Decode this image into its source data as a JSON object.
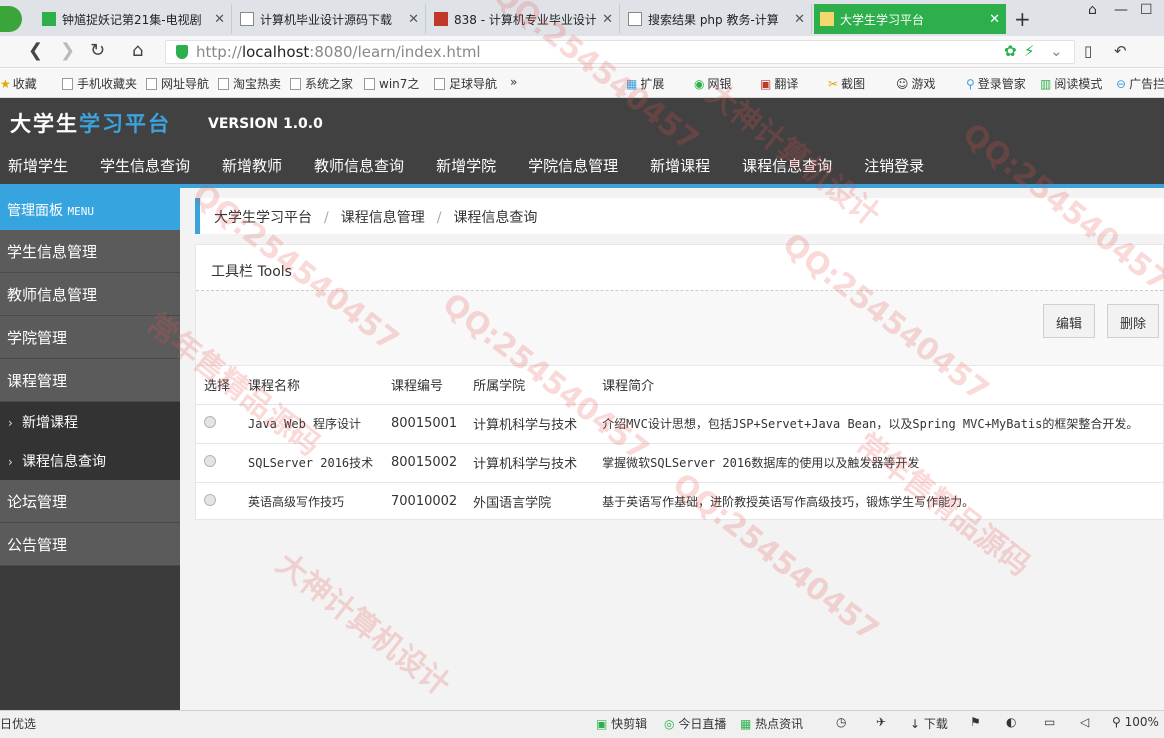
{
  "browser": {
    "tabs": [
      {
        "title": "钟馗捉妖记第21集-电视剧",
        "active": false
      },
      {
        "title": "计算机毕业设计源码下载",
        "active": false
      },
      {
        "title": "838 - 计算机专业毕业设计",
        "active": false
      },
      {
        "title": "搜索结果 php 教务-计算",
        "active": false
      },
      {
        "title": "大学生学习平台",
        "active": true
      }
    ],
    "url_prefix": "http://",
    "url_host": "localhost",
    "url_path": ":8080/learn/index.html",
    "bookmarks": [
      "收藏",
      "手机收藏夹",
      "网址导航",
      "淘宝热卖",
      "系统之家",
      "win7之",
      "足球导航",
      "»"
    ],
    "toolbar_right": [
      "扩展",
      "网银",
      "翻译",
      "截图",
      "游戏",
      "登录管家",
      "阅读模式",
      "广告拦"
    ]
  },
  "app": {
    "logo_part1": "大学生",
    "logo_part2": "学习平台",
    "version": "VERSION 1.0.0",
    "nav": [
      "新增学生",
      "学生信息查询",
      "新增教师",
      "教师信息查询",
      "新增学院",
      "学院信息管理",
      "新增课程",
      "课程信息查询",
      "注销登录"
    ]
  },
  "sidebar": {
    "header": "管理面板",
    "header_en": "MENU",
    "items_top": [
      "学生信息管理",
      "教师信息管理",
      "学院管理",
      "课程管理"
    ],
    "sub_items": [
      "新增课程",
      "课程信息查询"
    ],
    "items_bottom": [
      "论坛管理",
      "公告管理"
    ]
  },
  "breadcrumb": [
    "大学生学习平台",
    "课程信息管理",
    "课程信息查询"
  ],
  "toolbar": {
    "title": "工具栏 Tools",
    "edit": "编辑",
    "delete": "删除"
  },
  "table": {
    "headers": [
      "选择",
      "课程名称",
      "课程编号",
      "所属学院",
      "课程简介"
    ],
    "rows": [
      {
        "name": "Java Web 程序设计",
        "code": "80015001",
        "college": "计算机科学与技术",
        "desc": "介绍MVC设计思想，包括JSP+Servet+Java Bean，以及Spring MVC+MyBatis的框架整合开发。"
      },
      {
        "name": "SQLServer 2016技术",
        "code": "80015002",
        "college": "计算机科学与技术",
        "desc": "掌握微软SQLServer 2016数据库的使用以及触发器等开发"
      },
      {
        "name": "英语高级写作技巧",
        "code": "70010002",
        "college": "外国语言学院",
        "desc": "基于英语写作基础，进阶教授英语写作高级技巧，锻炼学生写作能力。"
      }
    ]
  },
  "statusbar": {
    "left": "日优选",
    "items": [
      "快剪辑",
      "今日直播",
      "热点资讯",
      "下载",
      "100%"
    ]
  },
  "watermark": [
    "QQ:254540457",
    "大神计算机设计",
    "常年售精品源码"
  ],
  "colors": {
    "accent": "#3ba2db",
    "header_bg": "#414141",
    "active_tab": "#2db04b"
  }
}
